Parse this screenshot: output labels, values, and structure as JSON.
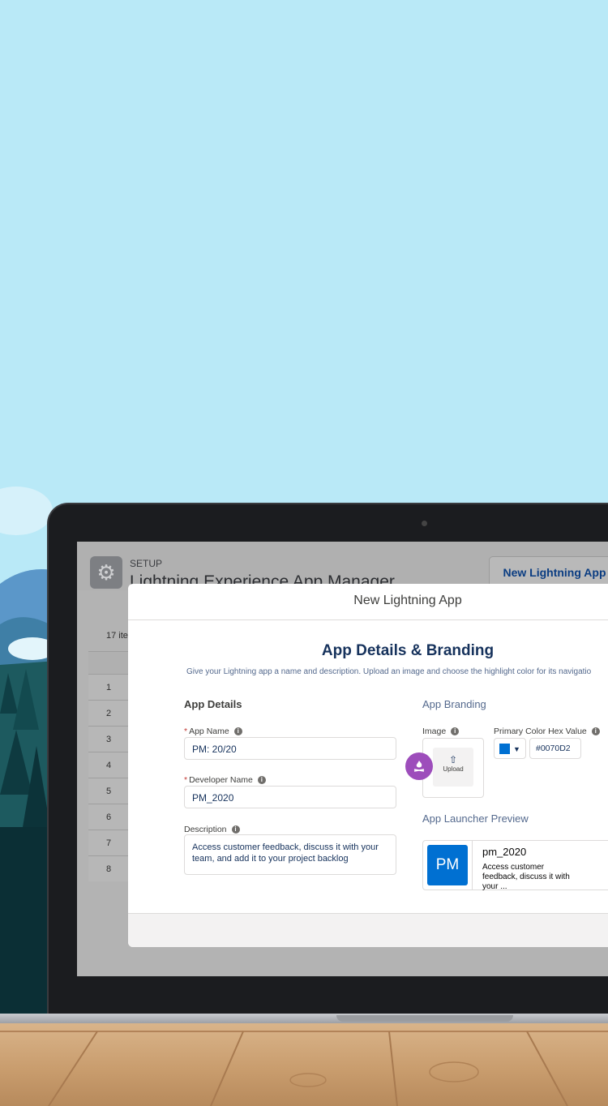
{
  "colors": {
    "sky": "#b9e9f7",
    "brand": "#0070d2",
    "badge": "#9d4dbb"
  },
  "setup": {
    "label": "SETUP",
    "title": "Lightning Experience App Manager",
    "new_app_button": "New Lightning App",
    "items_count": "17 ite",
    "row_numbers": [
      "1",
      "2",
      "3",
      "4",
      "5",
      "6",
      "7",
      "8"
    ]
  },
  "modal": {
    "title": "New Lightning App",
    "section_title": "App Details & Branding",
    "subtitle": "Give your Lightning app a name and description. Upload an image and choose the highlight color for its navigatio",
    "details": {
      "heading": "App Details",
      "app_name_label": "App Name",
      "app_name_value": "PM: 20/20",
      "dev_name_label": "Developer Name",
      "dev_name_value": "PM_2020",
      "description_label": "Description",
      "description_value": "Access customer feedback, discuss it with your team, and add it to your project backlog"
    },
    "branding": {
      "heading": "App Branding",
      "image_label": "Image",
      "upload_label": "Upload",
      "color_label": "Primary Color Hex Value",
      "color_value": "#0070D2",
      "preview_heading": "App Launcher Preview",
      "preview_initials": "PM",
      "preview_name": "pm_2020",
      "preview_desc": "Access customer feedback, discuss it with your ..."
    },
    "info_icon": "info-icon",
    "upload_icon": "upload-icon"
  }
}
